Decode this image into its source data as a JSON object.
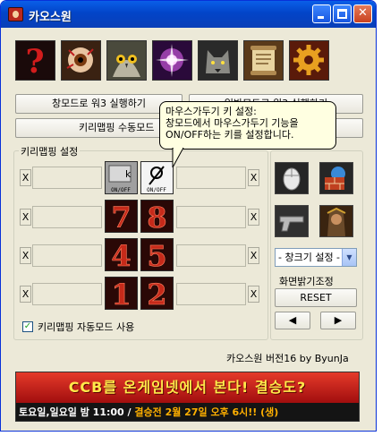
{
  "window": {
    "title": "카오스원",
    "buttons": {
      "minimize": "minimize-button",
      "maximize": "maximize-button",
      "close": "✕"
    }
  },
  "toolbar_icons": [
    {
      "icon": "question-mark-icon",
      "color": "#c81e1e"
    },
    {
      "icon": "eyeball-icon",
      "color": "#d8a070"
    },
    {
      "icon": "owl-icon",
      "color": "#8a8a7a"
    },
    {
      "icon": "magic-sparkle-icon",
      "color": "#d040e0"
    },
    {
      "icon": "wolf-icon",
      "color": "#6a6a6a"
    },
    {
      "icon": "scroll-icon",
      "color": "#c8a060"
    },
    {
      "icon": "gear-icon",
      "color": "#f0b020"
    }
  ],
  "buttons": {
    "window_mode_run": "창모드로 워3 실행하기",
    "fullscreen_run": "일반모드로 워3 실행하기",
    "keymap_manual": "키리맵핑 수동모드"
  },
  "tooltip": {
    "title": "마우스가두기 키 설정:",
    "line2": "창모드에서 마우스가두기 기능을",
    "line3": "ON/OFF하는 키를 설정합니다."
  },
  "keymap_group": {
    "label": "키리맵핑 설정",
    "x_label": "X",
    "toggle_captions": {
      "keyboard": "ON/OFF",
      "mouse": "ON/OFF"
    },
    "keys": [
      "7",
      "8",
      "4",
      "5",
      "1",
      "2"
    ]
  },
  "auto_mode": {
    "checked": true,
    "label": "키리맵핑 자동모드 사용"
  },
  "right_panel": {
    "tool_icons": [
      "mouse-icon",
      "firewall-icon",
      "pistol-icon",
      "warrior-portrait-icon"
    ],
    "window_size_select": "- 창크기 설정 -",
    "brightness_label": "화면밝기조정",
    "reset_label": "RESET",
    "left_arrow": "◀",
    "right_arrow": "▶"
  },
  "footer": {
    "version": "카오스원 버전16",
    "author": "by ByunJa"
  },
  "banner": {
    "headline": "CCB를 온게임넷에서 본다! 결승도?",
    "schedule": "토요일,일요일 밤 11:00",
    "separator": " / ",
    "final": "결승전 2월 27일 오후 6시!! (생)"
  }
}
